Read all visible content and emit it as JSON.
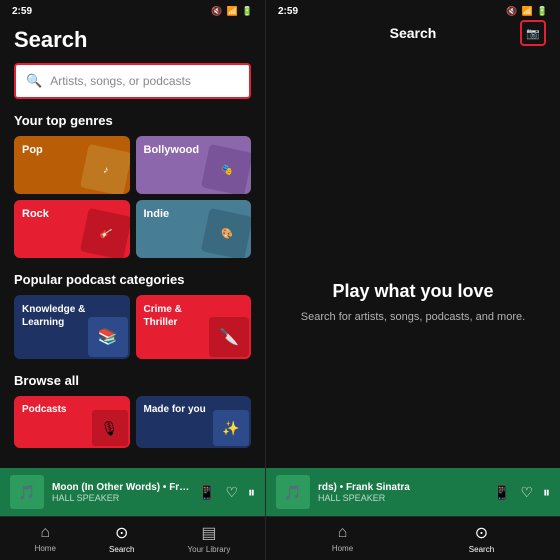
{
  "left": {
    "status_time": "2:59",
    "status_icons": "⚡📶🔋",
    "page_title": "Search",
    "search_placeholder": "Artists, songs, or podcasts",
    "top_genres_label": "Your top genres",
    "genres": [
      {
        "id": "pop",
        "label": "Pop",
        "bg": "#ba5d07",
        "emoji": "🎵"
      },
      {
        "id": "bollywood",
        "label": "Bollywood",
        "bg": "#8d67ab",
        "emoji": "🎬"
      },
      {
        "id": "rock",
        "label": "Rock",
        "bg": "#e61e32",
        "emoji": "🎸"
      },
      {
        "id": "indie",
        "label": "Indie",
        "bg": "#477d95",
        "emoji": "🎨"
      }
    ],
    "podcast_label": "Popular podcast categories",
    "podcasts": [
      {
        "id": "knowledge",
        "label": "Knowledge &\nLearning",
        "bg": "#1e3264",
        "emoji": "📚"
      },
      {
        "id": "crime",
        "label": "Crime &\nThriller",
        "bg": "#e61e32",
        "emoji": "🔪"
      }
    ],
    "browse_label": "Browse all",
    "browse": [
      {
        "id": "podcasts-browse",
        "label": "Podcasts",
        "bg": "#e61e32",
        "emoji": "🎙"
      },
      {
        "id": "made-for-you",
        "label": "Made for you",
        "bg": "#1e3264",
        "emoji": "✨"
      }
    ],
    "now_playing": {
      "title": "Moon (In Other Words) • Frank",
      "subtitle": "HALL SPEAKER",
      "emoji": "🎵"
    },
    "nav": [
      {
        "id": "home",
        "label": "Home",
        "icon": "⌂",
        "active": false
      },
      {
        "id": "search",
        "label": "Search",
        "icon": "⊙",
        "active": true
      },
      {
        "id": "library",
        "label": "Your Library",
        "icon": "▤",
        "active": false
      }
    ]
  },
  "right": {
    "status_time": "2:59",
    "header_title": "Search",
    "camera_icon": "📷",
    "main_title": "Play what you love",
    "main_subtitle": "Search for artists, songs, podcasts, and more.",
    "now_playing": {
      "title": "rds) • Frank Sinatra",
      "subtitle": "HALL SPEAKER",
      "emoji": "🎵"
    },
    "nav": [
      {
        "id": "home",
        "label": "Home",
        "icon": "⌂",
        "active": false
      },
      {
        "id": "search",
        "label": "Search",
        "icon": "⊙",
        "active": true
      }
    ]
  }
}
